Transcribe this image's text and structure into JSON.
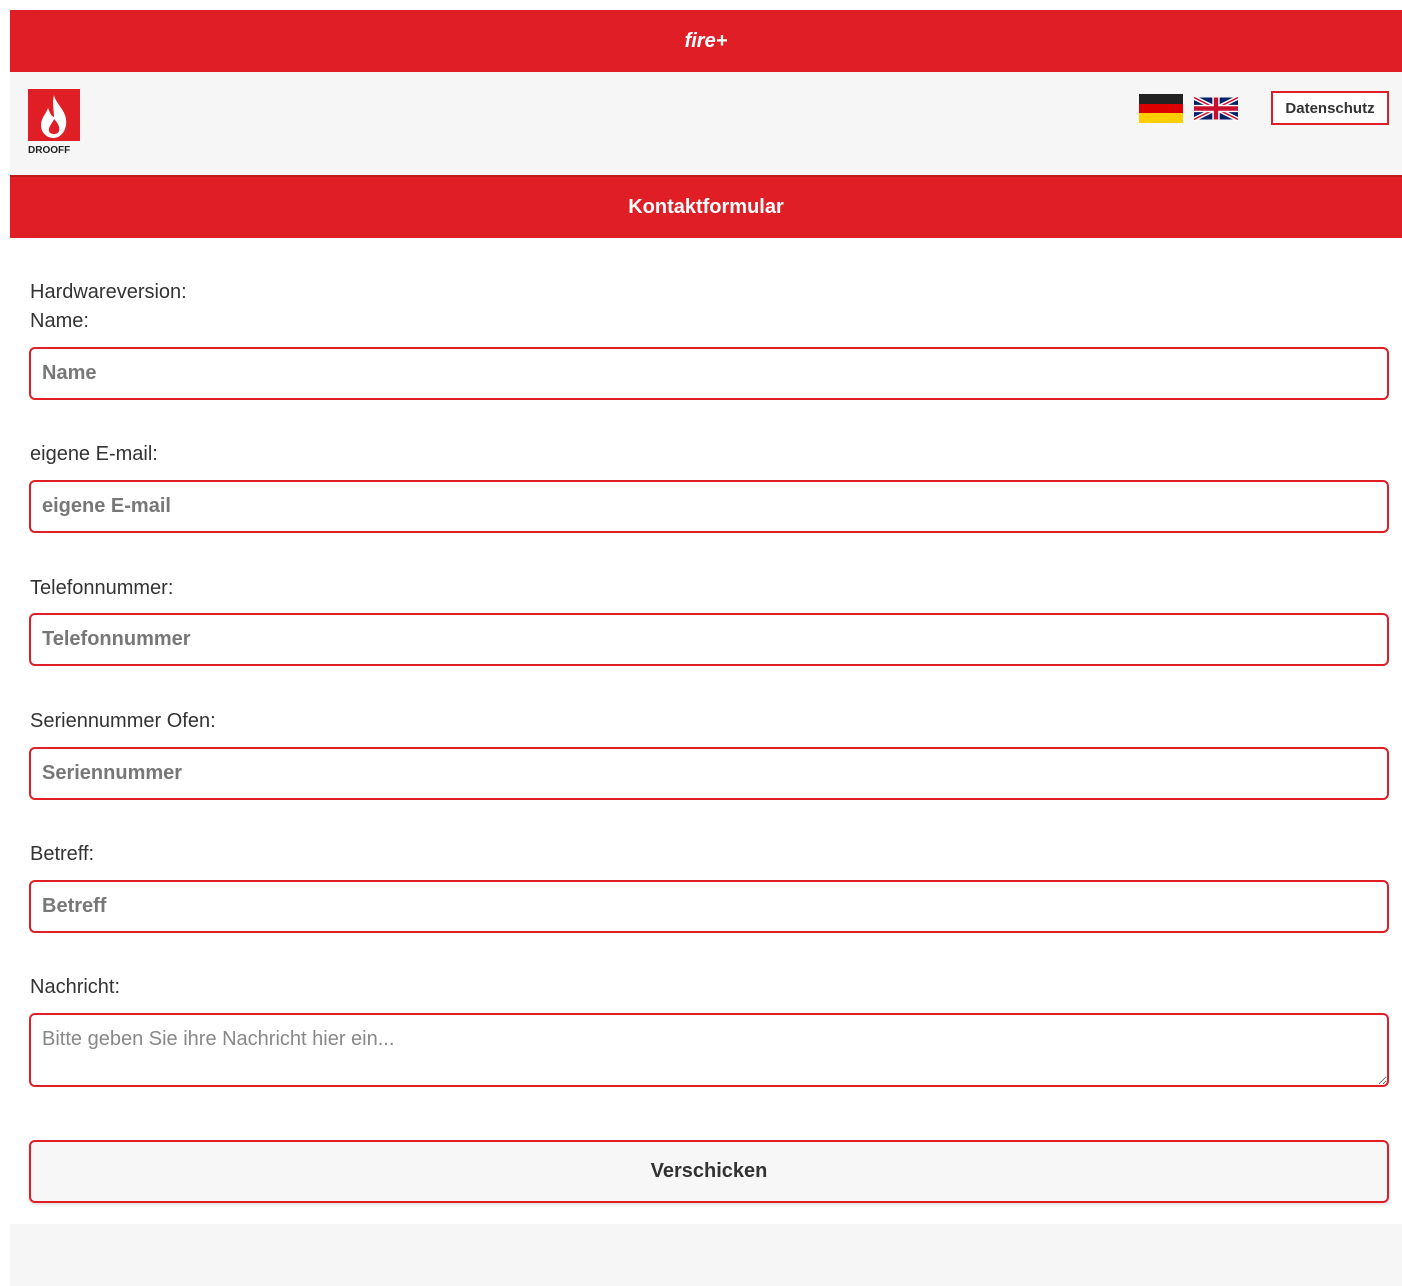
{
  "app_bar": {
    "title": "fire+"
  },
  "header": {
    "logo": {
      "icon": "drooff-flame-logo",
      "text": "DROOFF"
    },
    "languages": [
      {
        "name": "german-flag-icon",
        "label": "Deutsch"
      },
      {
        "name": "uk-flag-icon",
        "label": "English"
      }
    ],
    "privacy_label": "Datenschutz"
  },
  "section": {
    "title": "Kontaktformular"
  },
  "form": {
    "hardware_label": "Hardwareversion:",
    "name_label": "Name:",
    "name_placeholder": "Name",
    "email_label": "eigene E-mail:",
    "email_placeholder": "eigene E-mail",
    "phone_label": "Telefonnummer:",
    "phone_placeholder": "Telefonnummer",
    "serial_label": "Seriennummer Ofen:",
    "serial_placeholder": "Seriennummer",
    "subject_label": "Betreff:",
    "subject_placeholder": "Betreff",
    "message_label": "Nachricht:",
    "message_placeholder": "Bitte geben Sie ihre Nachricht hier ein...",
    "submit_label": "Verschicken"
  },
  "colors": {
    "accent": "#e01e25",
    "background": "#f6f6f6"
  }
}
